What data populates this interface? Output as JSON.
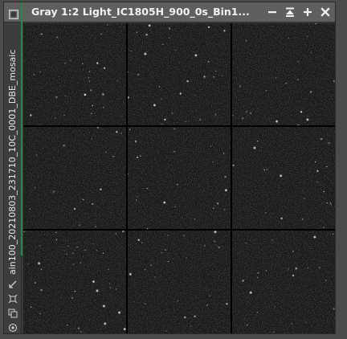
{
  "window": {
    "title": "Gray 1:2 Light_IC1805H_900_0s_Bin1...",
    "side_label": "ain100_20210803_231710_10C_0001_DBE_mosaic"
  },
  "controls": [
    {
      "name": "minimize-button",
      "icon": "minimize-icon"
    },
    {
      "name": "shade-button",
      "icon": "shade-icon"
    },
    {
      "name": "maximize-button",
      "icon": "maximize-icon"
    },
    {
      "name": "close-button",
      "icon": "close-icon"
    }
  ],
  "side_tools": [
    {
      "name": "pin-tool-button",
      "icon": "pin-icon"
    },
    {
      "name": "fit-view-button",
      "icon": "fit-view-icon"
    },
    {
      "name": "clone-view-button",
      "icon": "clone-icon"
    },
    {
      "name": "settings-tool-button",
      "icon": "target-icon"
    }
  ],
  "colors": {
    "accent": "#1b8f4a",
    "titlebar": "#5f5f5f",
    "image_background": "#1a1a1a",
    "grid_line": "#000000"
  },
  "image": {
    "grid_rows": 3,
    "grid_cols": 3
  }
}
